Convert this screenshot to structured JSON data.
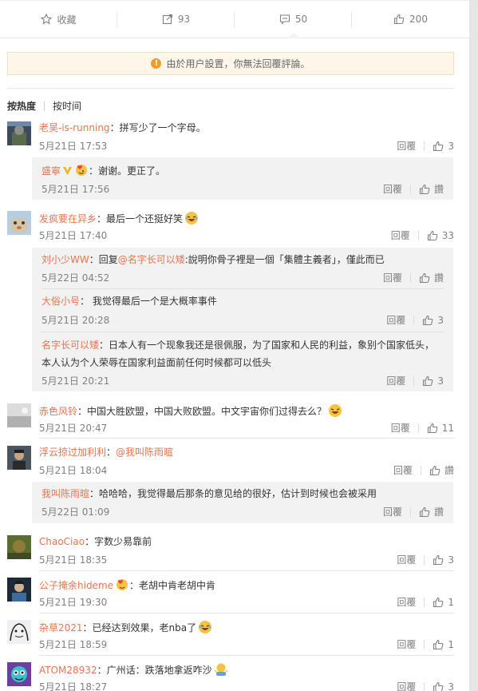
{
  "action_bar": {
    "favorite_label": "收藏",
    "forward_count": "93",
    "comment_count": "50",
    "like_count": "200"
  },
  "notice": {
    "text": "由於用户設置，你無法回覆評論。"
  },
  "sort": {
    "hot": "按热度",
    "time": "按时间"
  },
  "reply_label": "回覆",
  "like_zan": "讚",
  "comments": [
    {
      "user": "老吴-is-running",
      "text": "：拼写少了一个字母。",
      "time": "5月21日 17:53",
      "likes": "3"
    },
    {
      "user": "发疯要在异乡",
      "text": "：最后一个还挺好笑",
      "time": "5月21日 17:40",
      "likes": "33"
    },
    {
      "user": "赤色风铃",
      "text": "：中国大胜欧盟，中国大败欧盟。中文宇宙你们过得去么？",
      "time": "5月21日 20:47",
      "likes": "11"
    },
    {
      "user": "浮云掠过加利利",
      "mention": "@我叫陈雨暄",
      "text": "：",
      "time": "5月21日 18:04"
    },
    {
      "user": "ChaoCiao",
      "text": "：字数少易靠前",
      "time": "5月21日 18:35",
      "likes": "3"
    },
    {
      "user": "公子掩余hideme",
      "text": "：老胡中肯老胡中肯",
      "time": "5月21日 19:30",
      "likes": "1"
    },
    {
      "user": "杂草2021",
      "text": "：已经达到效果，老nba了",
      "time": "5月21日 18:59",
      "likes": "1"
    },
    {
      "user": "ATOM28932",
      "text": "：广州话：跌落地拿返咋沙",
      "time": "5月21日 18:27",
      "likes": "3"
    }
  ],
  "subs": [
    {
      "user": "盛寧",
      "text": "：谢谢。更正了。",
      "time": "5月21日 17:56"
    },
    {
      "user": "刘小少WW",
      "prefix": "：回复",
      "mention": "@名字长可以矮",
      "text": ":說明你骨子裡是一個「集體主義者」，僅此而已",
      "time": "5月22日 04:52"
    },
    {
      "user": "大俗小号",
      "text": "： 我觉得最后一个是大概率事件",
      "time": "5月21日 20:28",
      "likes": "3"
    },
    {
      "user": "名字长可以矮",
      "text": "：日本人有一个现象我还是很佩服，为了国家和人民的利益，象别个国家低头，",
      "text2": "本人认为个人荣辱在国家利益面前任何时候都可以低头",
      "time": "5月21日 20:21",
      "likes": "3"
    },
    {
      "user": "我叫陈雨暄",
      "text": "：哈哈哈，我觉得最后那条的意见给的很好，估计到时候也会被采用",
      "time": "5月22日 01:09"
    }
  ]
}
